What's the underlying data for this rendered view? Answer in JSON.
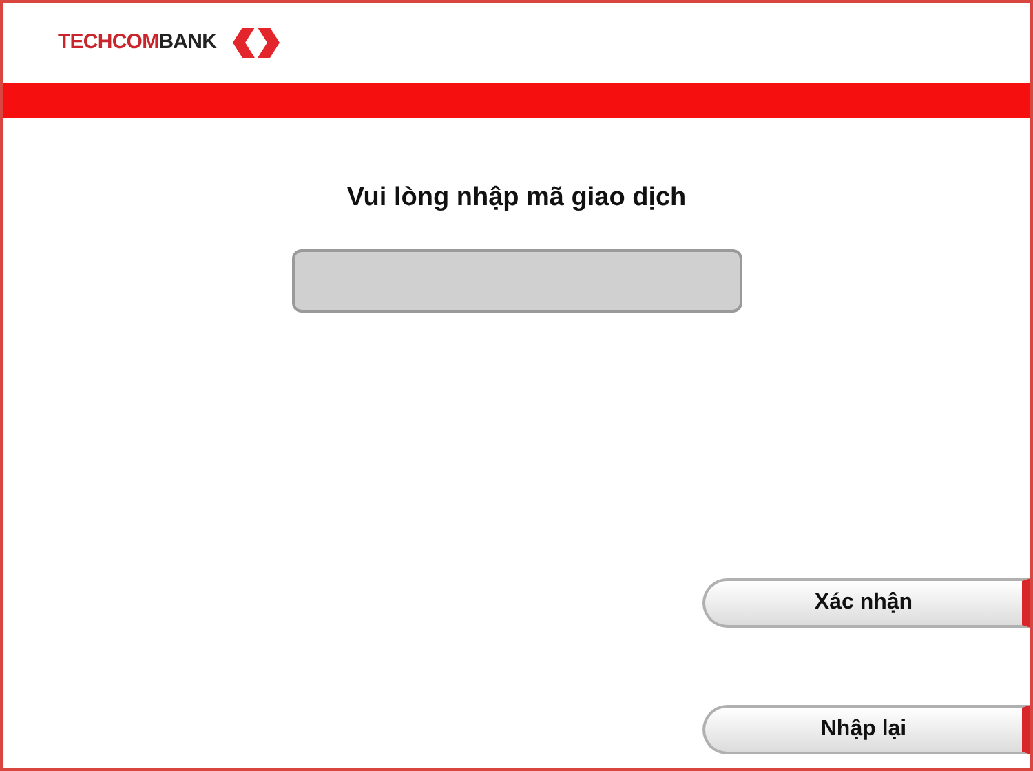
{
  "header": {
    "brand": {
      "red_part": "TECHCOM",
      "dark_part": "BANK"
    }
  },
  "prompt": "Vui lòng nhập mã giao dịch",
  "buttons": [
    {
      "label": "Xác nhận"
    },
    {
      "label": "Nhập lại"
    }
  ]
}
